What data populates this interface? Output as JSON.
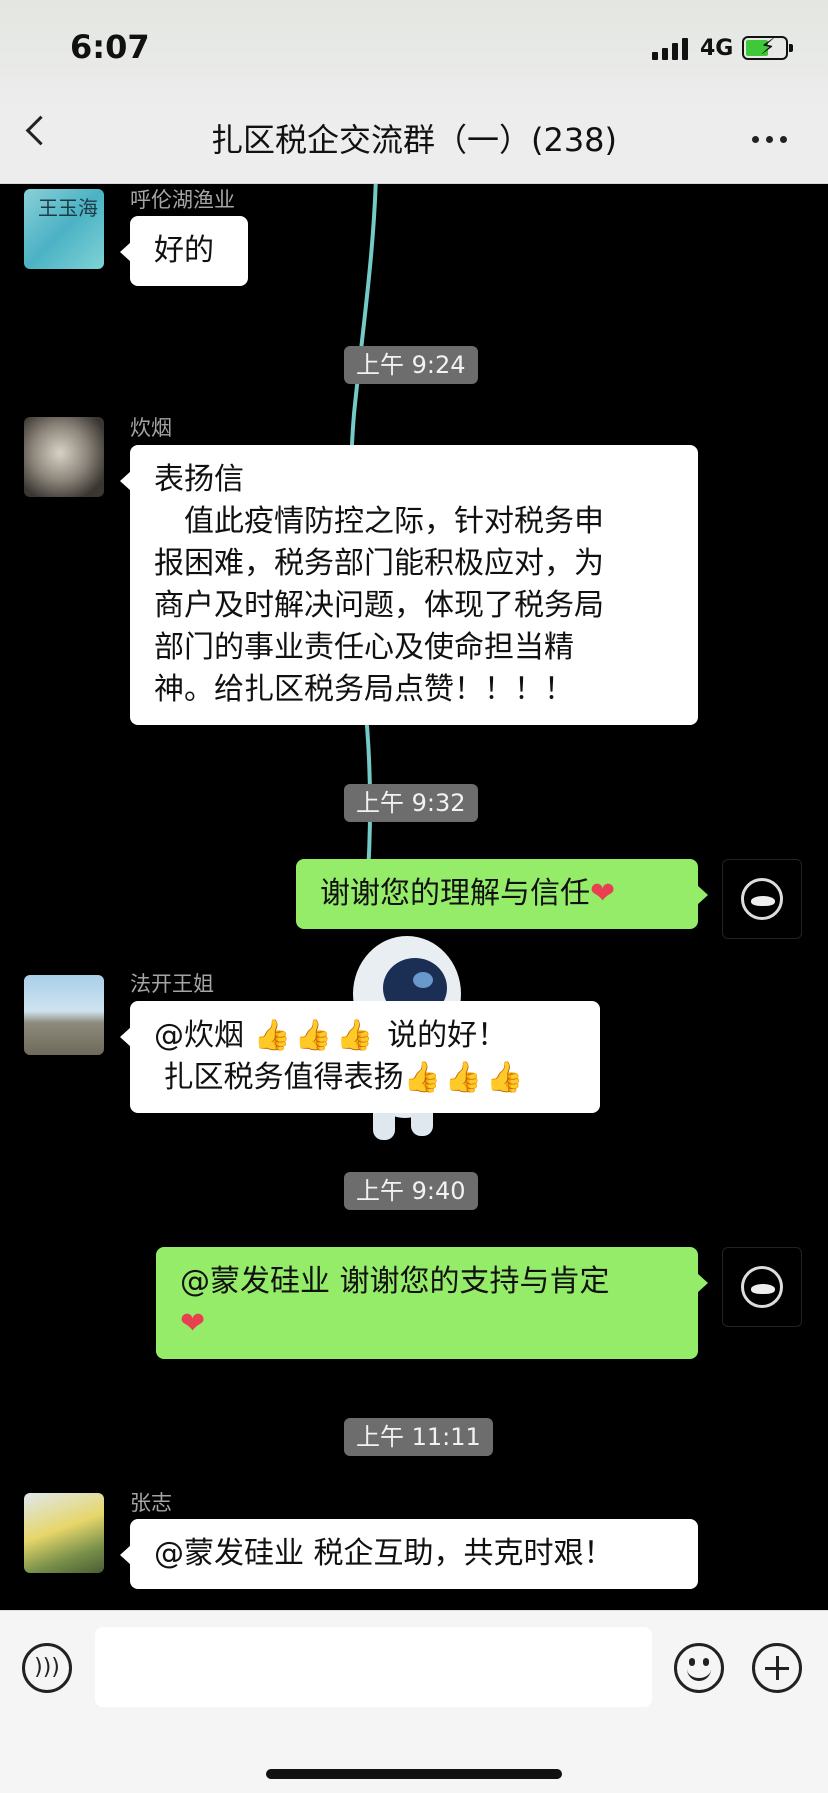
{
  "status_bar": {
    "time": "6:07",
    "network": "4G"
  },
  "header": {
    "title": "扎区税企交流群（一）(238)"
  },
  "messages": [
    {
      "sender": "呼伦湖渔业",
      "avatar_text": "王玉海",
      "lines": [
        "好的"
      ]
    },
    {
      "timestamp": "上午 9:24"
    },
    {
      "sender": "炊烟",
      "lines": [
        "表扬信",
        "　值此疫情防控之际，针对税务申",
        "报困难，税务部门能积极应对，为",
        "商户及时解决问题，体现了税务局",
        "部门的事业责任心及使命担当精",
        "神。给扎区税务局点赞！！！！"
      ]
    },
    {
      "timestamp": "上午 9:32"
    },
    {
      "sender": "me",
      "text": "谢谢您的理解与信任",
      "emoji": "❤"
    },
    {
      "sender": "法开王姐",
      "line1_prefix": "@炊烟 ",
      "line1_thumbs": "👍👍👍",
      "line1_suffix": " 说的好！",
      "line2_prefix": " 扎区税务值得表扬",
      "line2_thumbs": "👍👍👍"
    },
    {
      "timestamp": "上午 9:40"
    },
    {
      "sender": "me",
      "text": "@蒙发硅业 谢谢您的支持与肯定",
      "emoji": "❤"
    },
    {
      "timestamp": "上午 11:11"
    },
    {
      "sender": "张志",
      "text": "@蒙发硅业 税企互助，共克时艰！"
    }
  ],
  "icons": {
    "back": "chevron-left-icon",
    "more": "more-icon",
    "voice": "voice-icon",
    "emoji": "emoji-icon",
    "plus": "plus-icon"
  },
  "colors": {
    "sent_bubble": "#95ec69",
    "received_bubble": "#ffffff",
    "chat_background": "#000000",
    "timestamp_bg": "#6d6d6d"
  }
}
